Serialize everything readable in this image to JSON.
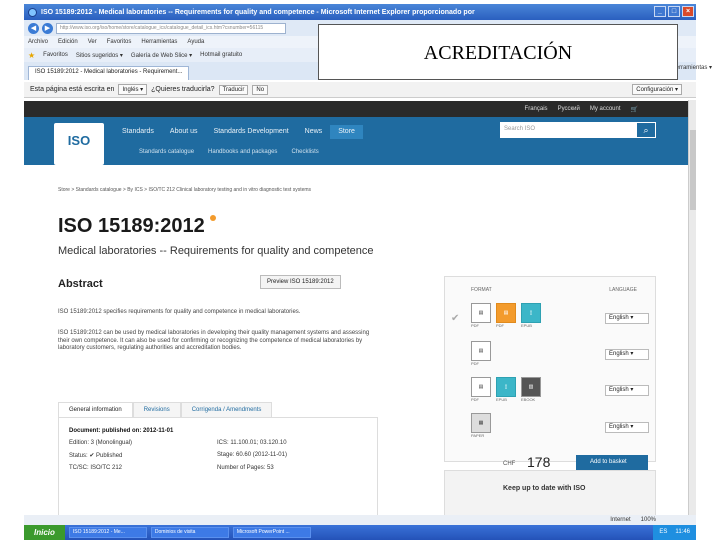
{
  "window": {
    "title": "ISO 15189:2012 - Medical laboratories -- Requirements for quality and competence - Microsoft Internet Explorer proporcionado por",
    "url": "http://www.iso.org/iso/home/store/catalogue_ics/catalogue_detail_ics.htm?csnumber=56115",
    "menu": [
      "Archivo",
      "Edición",
      "Ver",
      "Favoritos",
      "Herramientas",
      "Ayuda"
    ],
    "favorites": [
      "Favoritos",
      "Sitios sugeridos ▾",
      "Galería de Web Slice ▾",
      "Hotmail gratuito"
    ],
    "tab": "ISO 15189:2012 - Medical laboratories - Requirement...",
    "tools": "Página ▾ Seguridad ▾ Herramientas ▾"
  },
  "translate": {
    "prompt": "Esta página está escrita en",
    "lang": "Inglés ▾",
    "question": "¿Quieres traducirla?",
    "translate_btn": "Traducir",
    "no_btn": "No",
    "config": "Configuración ▾"
  },
  "site": {
    "langbar": [
      "Français",
      "Русский",
      "My account",
      "🛒"
    ],
    "logo": "ISO",
    "nav": [
      "Standards",
      "About us",
      "Standards Development",
      "News",
      "Store"
    ],
    "subnav": [
      "Standards catalogue",
      "Handbooks and packages",
      "Checklists"
    ],
    "search_placeholder": "Search ISO"
  },
  "page": {
    "breadcrumb": "Store > Standards catalogue > By ICS > ISO/TC 212 Clinical laboratory testing and in vitro diagnostic test systems",
    "title": "ISO 15189:2012",
    "subtitle": "Medical laboratories -- Requirements for quality and competence",
    "abstract_heading": "Abstract",
    "preview_btn": "Preview ISO 15189:2012",
    "para1": "ISO 15189:2012 specifies requirements for quality and competence in medical laboratories.",
    "para2": "ISO 15189:2012 can be used by medical laboratories in developing their quality management systems and assessing their own competence. It can also be used for confirming or recognizing the competence of medical laboratories by laboratory customers, regulating authorities and accreditation bodies.",
    "tabs": [
      "General information",
      "Revisions",
      "Corrigenda / Amendments"
    ],
    "info": {
      "published": "Document: published on: 2012-11-01",
      "edition": "Edition: 3 (Monolingual)",
      "ics": "ICS: 11.100.01; 03.120.10",
      "status": "Status: ✔ Published",
      "stage": "Stage: 60.60 (2012-11-01)",
      "tcsc": "TC/SC: ISO/TC 212",
      "pages": "Number of Pages: 53"
    }
  },
  "buy": {
    "format_hdr": "FORMAT",
    "lang_hdr": "LANGUAGE",
    "rows": [
      {
        "formats": [
          "PDF",
          "PDF",
          "EPUB"
        ],
        "lang": "English ▾"
      },
      {
        "formats": [
          "PDF"
        ],
        "lang": "English ▾"
      },
      {
        "formats": [
          "PDF",
          "EPUB",
          "EBOOK"
        ],
        "lang": "English ▾"
      },
      {
        "formats": [
          "PAPER"
        ],
        "lang": "English ▾"
      }
    ],
    "currency": "CHF",
    "price": "178",
    "add_btn": "Add to basket",
    "keepup": "Keep up to date with ISO"
  },
  "statusbar": {
    "zone": "Internet",
    "zoom": "100%"
  },
  "taskbar": {
    "start": "Inicio",
    "items": [
      "ISO 15189:2012 - Me...",
      "Dominios de visita",
      "Microsoft PowerPoint ..."
    ],
    "lang": "ES",
    "time": "11:46"
  },
  "overlay": {
    "label": "ACREDITACIÓN"
  }
}
